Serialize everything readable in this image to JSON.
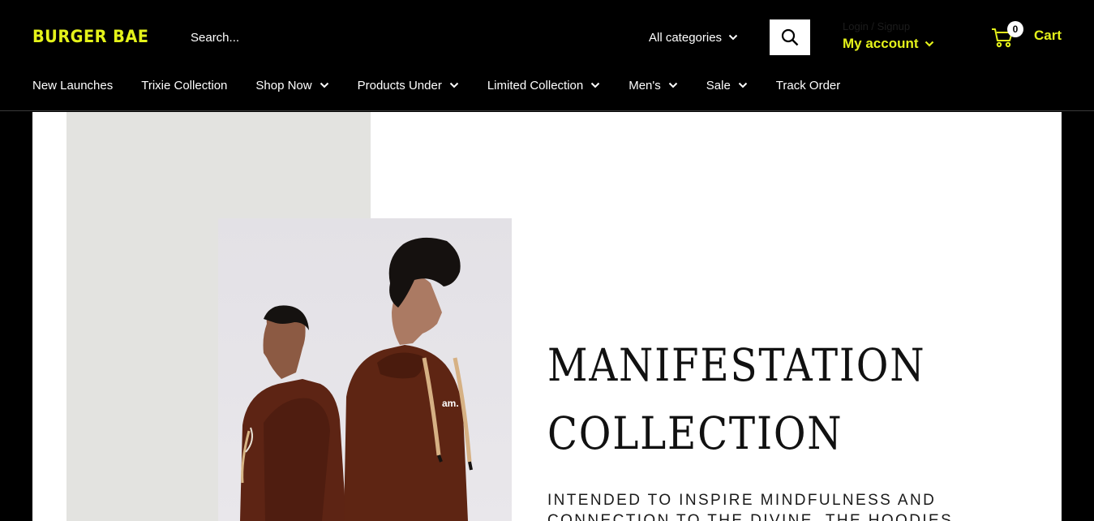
{
  "brand": {
    "logo": "BURGER BAE",
    "accent": "#e4f21a"
  },
  "search": {
    "placeholder": "Search...",
    "category": "All categories"
  },
  "account": {
    "login_label": "Login / Signup",
    "my_account_label": "My account"
  },
  "cart": {
    "count": "0",
    "label": "Cart"
  },
  "nav": {
    "items": [
      {
        "label": "New Launches"
      },
      {
        "label": "Trixie Collection"
      },
      {
        "label": "Shop Now"
      },
      {
        "label": "Products Under"
      },
      {
        "label": "Limited Collection"
      },
      {
        "label": "Men's"
      },
      {
        "label": "Sale"
      },
      {
        "label": "Track Order"
      }
    ]
  },
  "banner": {
    "title_line1": "MANIFESTATION",
    "title_line2": "COLLECTION",
    "subtitle_line1": "INTENDED TO INSPIRE MINDFULNESS AND",
    "subtitle_line2": "CONNECTION TO THE DIVINE. THE HOODIES",
    "hoodie_print": "am."
  }
}
